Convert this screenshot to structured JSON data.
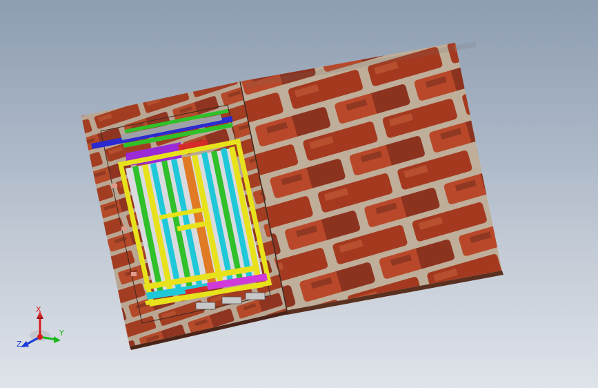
{
  "viewport": {
    "background_top": "#8e9db1",
    "background_bottom": "#dfe3ea"
  },
  "model": {
    "left_board_texture": "brick",
    "right_board_texture": "brick",
    "assembly": "frame-structure",
    "colors": {
      "brick": "#9a3b22",
      "mortar": "#b9a794",
      "frame_yellow": "#e8e21c",
      "frame_green": "#2fc02a",
      "frame_cyan": "#1fc8d8",
      "frame_blue": "#2a2ad0",
      "frame_purple": "#9a2ad6",
      "frame_magenta": "#d03ad8",
      "frame_orange": "#e07a24",
      "frame_red": "#d42a2a",
      "frame_gray": "#9ea2a8"
    }
  },
  "triad": {
    "x_label": "X",
    "y_label": "Y",
    "z_label": "Z",
    "x_color": "#d81c1c",
    "y_color": "#1cb81c",
    "z_color": "#1c3cd8"
  }
}
